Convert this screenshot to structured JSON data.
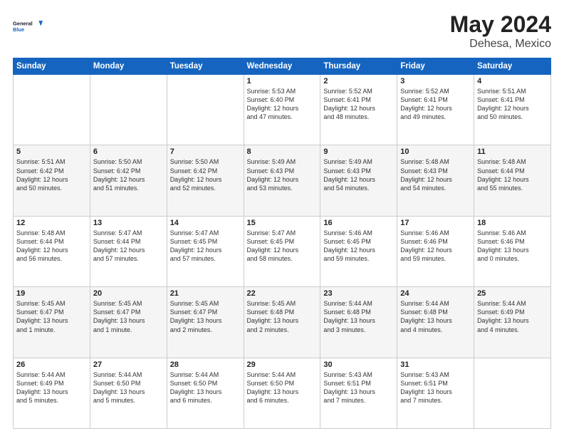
{
  "header": {
    "logo_line1": "General",
    "logo_line2": "Blue",
    "month": "May 2024",
    "location": "Dehesa, Mexico"
  },
  "weekdays": [
    "Sunday",
    "Monday",
    "Tuesday",
    "Wednesday",
    "Thursday",
    "Friday",
    "Saturday"
  ],
  "weeks": [
    [
      {
        "day": "",
        "info": ""
      },
      {
        "day": "",
        "info": ""
      },
      {
        "day": "",
        "info": ""
      },
      {
        "day": "1",
        "info": "Sunrise: 5:53 AM\nSunset: 6:40 PM\nDaylight: 12 hours\nand 47 minutes."
      },
      {
        "day": "2",
        "info": "Sunrise: 5:52 AM\nSunset: 6:41 PM\nDaylight: 12 hours\nand 48 minutes."
      },
      {
        "day": "3",
        "info": "Sunrise: 5:52 AM\nSunset: 6:41 PM\nDaylight: 12 hours\nand 49 minutes."
      },
      {
        "day": "4",
        "info": "Sunrise: 5:51 AM\nSunset: 6:41 PM\nDaylight: 12 hours\nand 50 minutes."
      }
    ],
    [
      {
        "day": "5",
        "info": "Sunrise: 5:51 AM\nSunset: 6:42 PM\nDaylight: 12 hours\nand 50 minutes."
      },
      {
        "day": "6",
        "info": "Sunrise: 5:50 AM\nSunset: 6:42 PM\nDaylight: 12 hours\nand 51 minutes."
      },
      {
        "day": "7",
        "info": "Sunrise: 5:50 AM\nSunset: 6:42 PM\nDaylight: 12 hours\nand 52 minutes."
      },
      {
        "day": "8",
        "info": "Sunrise: 5:49 AM\nSunset: 6:43 PM\nDaylight: 12 hours\nand 53 minutes."
      },
      {
        "day": "9",
        "info": "Sunrise: 5:49 AM\nSunset: 6:43 PM\nDaylight: 12 hours\nand 54 minutes."
      },
      {
        "day": "10",
        "info": "Sunrise: 5:48 AM\nSunset: 6:43 PM\nDaylight: 12 hours\nand 54 minutes."
      },
      {
        "day": "11",
        "info": "Sunrise: 5:48 AM\nSunset: 6:44 PM\nDaylight: 12 hours\nand 55 minutes."
      }
    ],
    [
      {
        "day": "12",
        "info": "Sunrise: 5:48 AM\nSunset: 6:44 PM\nDaylight: 12 hours\nand 56 minutes."
      },
      {
        "day": "13",
        "info": "Sunrise: 5:47 AM\nSunset: 6:44 PM\nDaylight: 12 hours\nand 57 minutes."
      },
      {
        "day": "14",
        "info": "Sunrise: 5:47 AM\nSunset: 6:45 PM\nDaylight: 12 hours\nand 57 minutes."
      },
      {
        "day": "15",
        "info": "Sunrise: 5:47 AM\nSunset: 6:45 PM\nDaylight: 12 hours\nand 58 minutes."
      },
      {
        "day": "16",
        "info": "Sunrise: 5:46 AM\nSunset: 6:45 PM\nDaylight: 12 hours\nand 59 minutes."
      },
      {
        "day": "17",
        "info": "Sunrise: 5:46 AM\nSunset: 6:46 PM\nDaylight: 12 hours\nand 59 minutes."
      },
      {
        "day": "18",
        "info": "Sunrise: 5:46 AM\nSunset: 6:46 PM\nDaylight: 13 hours\nand 0 minutes."
      }
    ],
    [
      {
        "day": "19",
        "info": "Sunrise: 5:45 AM\nSunset: 6:47 PM\nDaylight: 13 hours\nand 1 minute."
      },
      {
        "day": "20",
        "info": "Sunrise: 5:45 AM\nSunset: 6:47 PM\nDaylight: 13 hours\nand 1 minute."
      },
      {
        "day": "21",
        "info": "Sunrise: 5:45 AM\nSunset: 6:47 PM\nDaylight: 13 hours\nand 2 minutes."
      },
      {
        "day": "22",
        "info": "Sunrise: 5:45 AM\nSunset: 6:48 PM\nDaylight: 13 hours\nand 2 minutes."
      },
      {
        "day": "23",
        "info": "Sunrise: 5:44 AM\nSunset: 6:48 PM\nDaylight: 13 hours\nand 3 minutes."
      },
      {
        "day": "24",
        "info": "Sunrise: 5:44 AM\nSunset: 6:48 PM\nDaylight: 13 hours\nand 4 minutes."
      },
      {
        "day": "25",
        "info": "Sunrise: 5:44 AM\nSunset: 6:49 PM\nDaylight: 13 hours\nand 4 minutes."
      }
    ],
    [
      {
        "day": "26",
        "info": "Sunrise: 5:44 AM\nSunset: 6:49 PM\nDaylight: 13 hours\nand 5 minutes."
      },
      {
        "day": "27",
        "info": "Sunrise: 5:44 AM\nSunset: 6:50 PM\nDaylight: 13 hours\nand 5 minutes."
      },
      {
        "day": "28",
        "info": "Sunrise: 5:44 AM\nSunset: 6:50 PM\nDaylight: 13 hours\nand 6 minutes."
      },
      {
        "day": "29",
        "info": "Sunrise: 5:44 AM\nSunset: 6:50 PM\nDaylight: 13 hours\nand 6 minutes."
      },
      {
        "day": "30",
        "info": "Sunrise: 5:43 AM\nSunset: 6:51 PM\nDaylight: 13 hours\nand 7 minutes."
      },
      {
        "day": "31",
        "info": "Sunrise: 5:43 AM\nSunset: 6:51 PM\nDaylight: 13 hours\nand 7 minutes."
      },
      {
        "day": "",
        "info": ""
      }
    ]
  ]
}
